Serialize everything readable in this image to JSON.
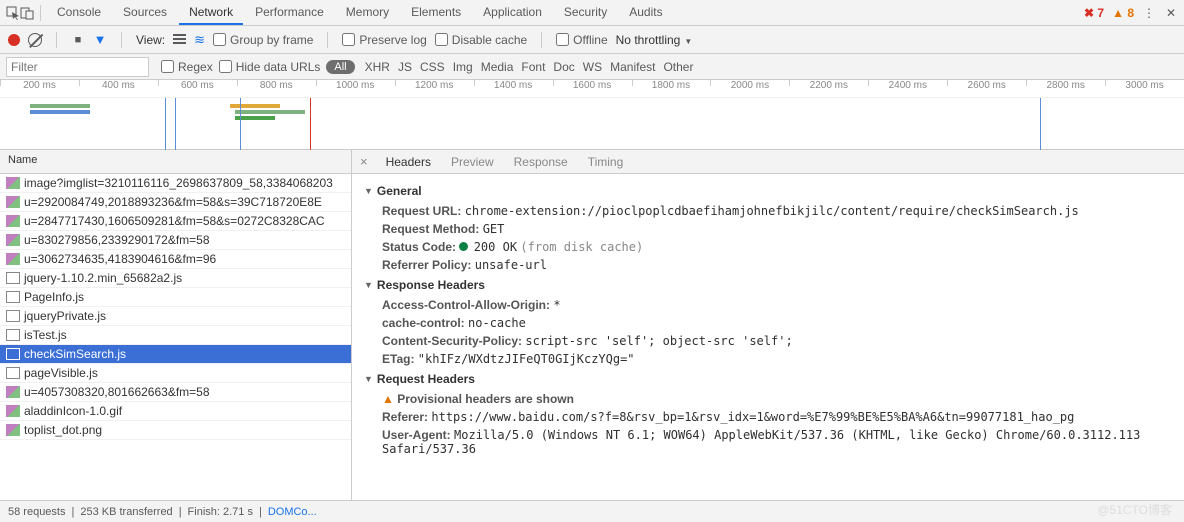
{
  "tabs": [
    "Console",
    "Sources",
    "Network",
    "Performance",
    "Memory",
    "Elements",
    "Application",
    "Security",
    "Audits"
  ],
  "activeTab": "Network",
  "errors": {
    "err_count": "7",
    "warn_count": "8"
  },
  "row2": {
    "view": "View:",
    "group": "Group by frame",
    "preserve": "Preserve log",
    "disable": "Disable cache",
    "offline": "Offline",
    "throttling": "No throttling"
  },
  "row3": {
    "filter_ph": "Filter",
    "regex": "Regex",
    "hide": "Hide data URLs",
    "all": "All",
    "types": [
      "XHR",
      "JS",
      "CSS",
      "Img",
      "Media",
      "Font",
      "Doc",
      "WS",
      "Manifest",
      "Other"
    ]
  },
  "timeline_ticks": [
    "200 ms",
    "400 ms",
    "600 ms",
    "800 ms",
    "1000 ms",
    "1200 ms",
    "1400 ms",
    "1600 ms",
    "1800 ms",
    "2000 ms",
    "2200 ms",
    "2400 ms",
    "2600 ms",
    "2800 ms",
    "3000 ms"
  ],
  "name_header": "Name",
  "requests": [
    {
      "t": "img",
      "n": "image?imglist=3210116116_2698637809_58,3384068203"
    },
    {
      "t": "img",
      "n": "u=2920084749,2018893236&fm=58&s=39C718720E8E"
    },
    {
      "t": "img",
      "n": "u=2847717430,1606509281&fm=58&s=0272C8328CAC"
    },
    {
      "t": "img",
      "n": "u=830279856,2339290172&fm=58"
    },
    {
      "t": "img",
      "n": "u=3062734635,4183904616&fm=96"
    },
    {
      "t": "js",
      "n": "jquery-1.10.2.min_65682a2.js"
    },
    {
      "t": "js",
      "n": "PageInfo.js"
    },
    {
      "t": "js",
      "n": "jqueryPrivate.js"
    },
    {
      "t": "js",
      "n": "isTest.js"
    },
    {
      "t": "js",
      "n": "checkSimSearch.js",
      "sel": true
    },
    {
      "t": "js",
      "n": "pageVisible.js"
    },
    {
      "t": "img",
      "n": "u=4057308320,801662663&fm=58"
    },
    {
      "t": "img",
      "n": "aladdinIcon-1.0.gif"
    },
    {
      "t": "img",
      "n": "toplist_dot.png"
    }
  ],
  "right_tabs": [
    "Headers",
    "Preview",
    "Response",
    "Timing"
  ],
  "right_active": "Headers",
  "general": {
    "title": "General",
    "url_k": "Request URL:",
    "url_v": "chrome-extension://pioclpoplcdbaefihamjohnefbikjilc/content/require/checkSimSearch.js",
    "method_k": "Request Method:",
    "method_v": "GET",
    "status_k": "Status Code:",
    "status_v": "200 OK",
    "status_note": "(from disk cache)",
    "ref_k": "Referrer Policy:",
    "ref_v": "unsafe-url"
  },
  "resp": {
    "title": "Response Headers",
    "aco_k": "Access-Control-Allow-Origin:",
    "aco_v": "*",
    "cc_k": "cache-control:",
    "cc_v": "no-cache",
    "csp_k": "Content-Security-Policy:",
    "csp_v": "script-src 'self'; object-src 'self';",
    "etag_k": "ETag:",
    "etag_v": "\"khIFz/WXdtzJIFeQT0GIjKczYQg=\""
  },
  "req": {
    "title": "Request Headers",
    "prov": "Provisional headers are shown",
    "ref_k": "Referer:",
    "ref_v": "https://www.baidu.com/s?f=8&rsv_bp=1&rsv_idx=1&word=%E7%99%BE%E5%BA%A6&tn=99077181_hao_pg",
    "ua_k": "User-Agent:",
    "ua_v": "Mozilla/5.0 (Windows NT 6.1; WOW64) AppleWebKit/537.36 (KHTML, like Gecko) Chrome/60.0.3112.113 Safari/537.36"
  },
  "footer": {
    "reqs": "58 requests",
    "xfer": "253 KB transferred",
    "finish": "Finish: 2.71 s",
    "dom": "DOMCo..."
  },
  "watermark": "@51CTO博客"
}
